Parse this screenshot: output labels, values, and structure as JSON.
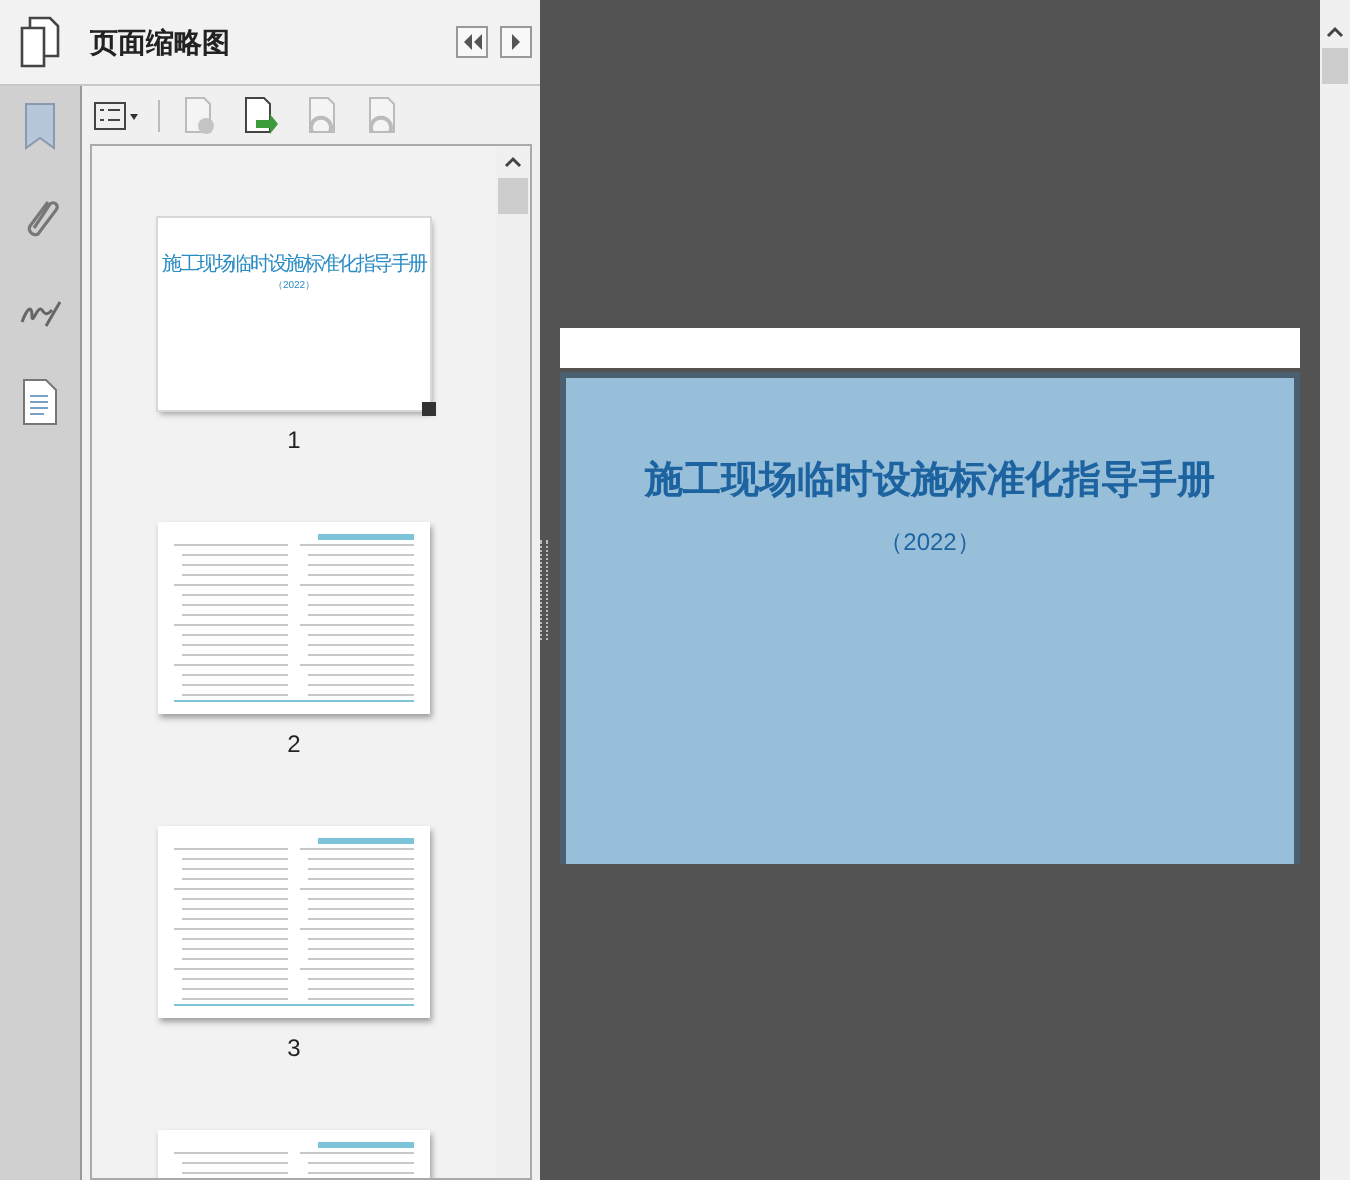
{
  "panel": {
    "title": "页面缩略图"
  },
  "thumbnails": [
    {
      "kind": "cover",
      "label": "1",
      "selected": true,
      "title": "施工现场临时设施标准化指导手册",
      "subtitle": "（2022）"
    },
    {
      "kind": "toc",
      "label": "2",
      "selected": false
    },
    {
      "kind": "toc",
      "label": "3",
      "selected": false
    },
    {
      "kind": "toc",
      "selected": false
    }
  ],
  "page": {
    "title": "施工现场临时设施标准化指导手册",
    "subtitle": "（2022）"
  }
}
